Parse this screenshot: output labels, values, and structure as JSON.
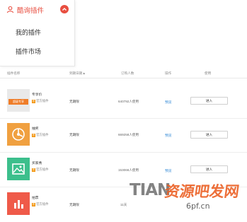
{
  "menu": {
    "title": "酷询插件",
    "items": [
      {
        "label": "我的插件"
      },
      {
        "label": "插件市场"
      }
    ]
  },
  "table": {
    "headers": [
      "插件名称",
      "到期日期▲",
      "订购人数",
      "操作",
      "使用"
    ],
    "rows": [
      {
        "name": "专享价",
        "badge_mark": "官",
        "badge": "官方插件",
        "expire": "无期限",
        "count": "640792人使用",
        "preview": "预览",
        "action": "进入",
        "thumb_color": "#e9e9e9",
        "thumb_icon": "professional-banner-icon"
      },
      {
        "name": "抽奖",
        "badge_mark": "官",
        "badge": "官方插件",
        "expire": "无期限",
        "count": "669258人使用",
        "preview": "预览",
        "action": "进入",
        "thumb_color": "#f0a040",
        "thumb_icon": "lottery-icon"
      },
      {
        "name": "买家秀",
        "badge_mark": "官",
        "badge": "官方插件",
        "expire": "无期限",
        "count": "153066人使用",
        "preview": "预览",
        "action": "进入",
        "thumb_color": "#3cbf8c",
        "thumb_icon": "image-icon"
      },
      {
        "name": "拍票",
        "badge_mark": "官",
        "badge": "官方插件",
        "expire": "无期限",
        "count": "11天",
        "preview": "预览",
        "action": "进入",
        "thumb_color": "#ef5a49",
        "thumb_icon": "bar-chart-icon"
      }
    ]
  },
  "row0_thumb_text": "超级专享",
  "watermark": {
    "left": "TIAN",
    "right": "资源吧发网",
    "url": "6pf.cn"
  },
  "colors": {
    "accent": "#e84e40",
    "link": "#3c8fd8",
    "badge": "#f29000"
  }
}
